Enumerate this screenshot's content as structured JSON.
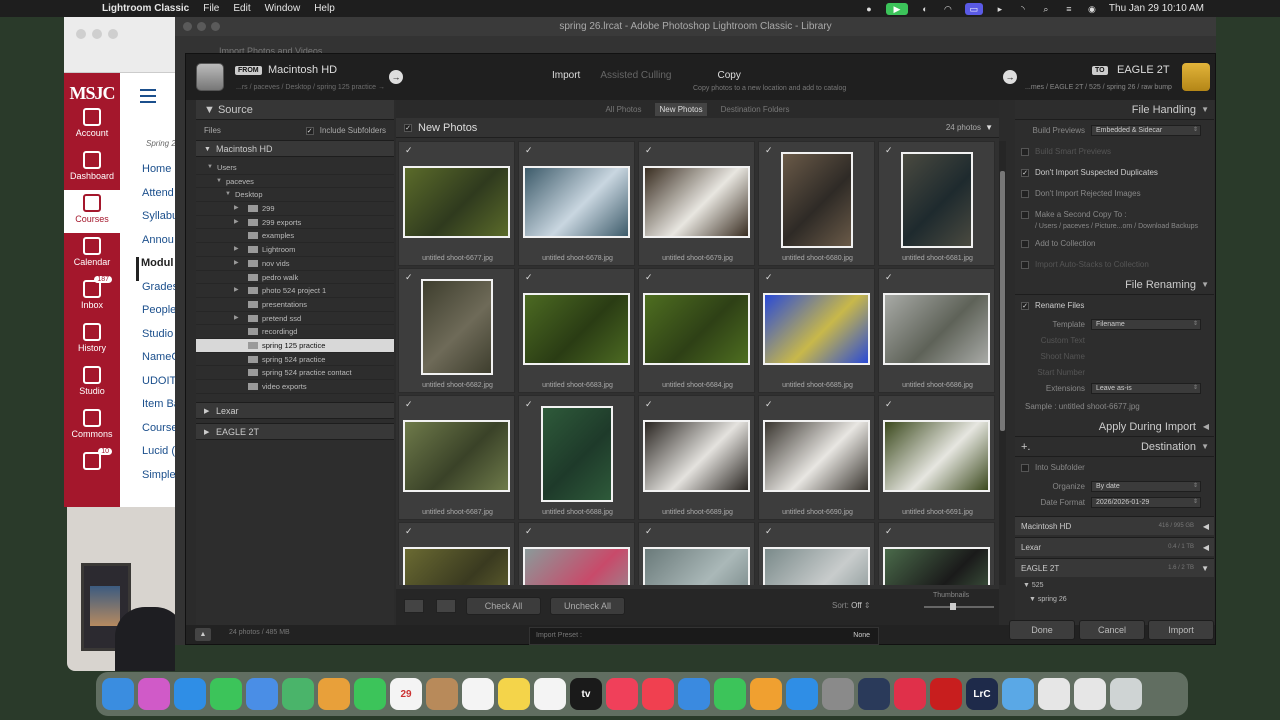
{
  "menubar": {
    "app": "Lightroom Classic",
    "items": [
      "File",
      "Edit",
      "Window",
      "Help"
    ],
    "clock": "Thu Jan 29  10:10 AM"
  },
  "browser": {
    "logo": "MSJC",
    "breadcrumb": "Spring 2",
    "nav": [
      {
        "label": "Account",
        "badge": ""
      },
      {
        "label": "Dashboard",
        "badge": ""
      },
      {
        "label": "Courses",
        "badge": ""
      },
      {
        "label": "Calendar",
        "badge": ""
      },
      {
        "label": "Inbox",
        "badge": "187"
      },
      {
        "label": "History",
        "badge": ""
      },
      {
        "label": "Studio",
        "badge": ""
      },
      {
        "label": "Commons",
        "badge": ""
      },
      {
        "label": "",
        "badge": "10"
      }
    ],
    "links": [
      "Home",
      "Attend",
      "Syllabu",
      "Annou",
      "Modul",
      "Grades",
      "People",
      "Studio",
      "NameC",
      "UDOIT",
      "Item Ba",
      "Course",
      "Lucid (",
      "Simple"
    ]
  },
  "lr_window": {
    "title": "spring 26.lrcat - Adobe Photoshop Lightroom Classic - Library",
    "subtitle": "Import Photos and Videos"
  },
  "import": {
    "from_tag": "FROM",
    "source_name": "Macintosh HD",
    "source_path": "...rs / paceves / Desktop / spring 125 practice →",
    "modes": {
      "import": "Import",
      "assisted": "Assisted Culling",
      "copy": "Copy"
    },
    "copy_hint": "Copy photos to a new location and add to catalog",
    "to_tag": "TO",
    "dest_name": "EAGLE 2T",
    "dest_path": "...mes / EAGLE 2T / 525 / spring 26 / raw bump"
  },
  "source_panel": {
    "header": "Source",
    "files_label": "Files",
    "include_subfolders": "Include Subfolders",
    "volume": "Macintosh HD",
    "tree": [
      {
        "label": "Users",
        "depth": 1,
        "tri": "▼",
        "folder": false
      },
      {
        "label": "paceves",
        "depth": 2,
        "tri": "▼",
        "folder": false
      },
      {
        "label": "Desktop",
        "depth": 3,
        "tri": "▼",
        "folder": false
      },
      {
        "label": "299",
        "depth": 4,
        "tri": "▶",
        "folder": true
      },
      {
        "label": "299 exports",
        "depth": 4,
        "tri": "▶",
        "folder": true
      },
      {
        "label": "examples",
        "depth": 4,
        "tri": "",
        "folder": true
      },
      {
        "label": "Lightroom",
        "depth": 4,
        "tri": "▶",
        "folder": true
      },
      {
        "label": "nov vids",
        "depth": 4,
        "tri": "▶",
        "folder": true
      },
      {
        "label": "pedro walk",
        "depth": 4,
        "tri": "",
        "folder": true
      },
      {
        "label": "photo 524 project 1",
        "depth": 4,
        "tri": "▶",
        "folder": true
      },
      {
        "label": "presentations",
        "depth": 4,
        "tri": "",
        "folder": true
      },
      {
        "label": "pretend ssd",
        "depth": 4,
        "tri": "▶",
        "folder": true
      },
      {
        "label": "recordingd",
        "depth": 4,
        "tri": "",
        "folder": true
      },
      {
        "label": "spring 125 practice",
        "depth": 4,
        "tri": "",
        "folder": true,
        "selected": true
      },
      {
        "label": "spring 524 practice",
        "depth": 4,
        "tri": "",
        "folder": true
      },
      {
        "label": "spring 524 practice  contact",
        "depth": 4,
        "tri": "",
        "folder": true
      },
      {
        "label": "video exports",
        "depth": 4,
        "tri": "",
        "folder": true
      }
    ],
    "other_volumes": [
      "Lexar",
      "EAGLE 2T"
    ]
  },
  "grid": {
    "tabs": [
      "All Photos",
      "New Photos",
      "Destination Folders"
    ],
    "header": "New Photos",
    "count": "24 photos",
    "photos": [
      {
        "name": "untitled shoot-6677.jpg",
        "colors": [
          "#5b6b2a",
          "#2f3a1e"
        ],
        "portrait": false
      },
      {
        "name": "untitled shoot-6678.jpg",
        "colors": [
          "#3d5b6a",
          "#c9d6e0"
        ],
        "portrait": false
      },
      {
        "name": "untitled shoot-6679.jpg",
        "colors": [
          "#3a2e22",
          "#e8e6e0"
        ],
        "portrait": false
      },
      {
        "name": "untitled shoot-6680.jpg",
        "colors": [
          "#6a5a48",
          "#2e2a26"
        ],
        "portrait": true
      },
      {
        "name": "untitled shoot-6681.jpg",
        "colors": [
          "#4a4a40",
          "#1e2a2e"
        ],
        "portrait": true
      },
      {
        "name": "untitled shoot-6682.jpg",
        "colors": [
          "#3e3e2e",
          "#6e6a58"
        ],
        "portrait": true
      },
      {
        "name": "untitled shoot-6683.jpg",
        "colors": [
          "#4c6a22",
          "#2a3c14"
        ],
        "portrait": false
      },
      {
        "name": "untitled shoot-6684.jpg",
        "colors": [
          "#4e6e20",
          "#2e4016"
        ],
        "portrait": false
      },
      {
        "name": "untitled shoot-6685.jpg",
        "colors": [
          "#2a4ad6",
          "#c8b84a"
        ],
        "portrait": false
      },
      {
        "name": "untitled shoot-6686.jpg",
        "colors": [
          "#a8aaa6",
          "#5e6258"
        ],
        "portrait": false
      },
      {
        "name": "untitled shoot-6687.jpg",
        "colors": [
          "#6e7a4a",
          "#3a4228"
        ],
        "portrait": false
      },
      {
        "name": "untitled shoot-6688.jpg",
        "colors": [
          "#2e5a3a",
          "#1e3a2a"
        ],
        "portrait": true
      },
      {
        "name": "untitled shoot-6689.jpg",
        "colors": [
          "#2a2622",
          "#e4e2de"
        ],
        "portrait": false
      },
      {
        "name": "untitled shoot-6690.jpg",
        "colors": [
          "#3a3630",
          "#e8e6e2"
        ],
        "portrait": false
      },
      {
        "name": "untitled shoot-6691.jpg",
        "colors": [
          "#3c4a1e",
          "#e6e6e0"
        ],
        "portrait": false
      },
      {
        "name": "",
        "colors": [
          "#6a6a32",
          "#3a3a20"
        ],
        "portrait": false
      },
      {
        "name": "",
        "colors": [
          "#8a9a9a",
          "#c84a6a"
        ],
        "portrait": false
      },
      {
        "name": "",
        "colors": [
          "#6a7a7a",
          "#aab8b8"
        ],
        "portrait": false
      },
      {
        "name": "",
        "colors": [
          "#7a8a8a",
          "#c8cccc"
        ],
        "portrait": false
      },
      {
        "name": "",
        "colors": [
          "#4a6a4a",
          "#1a1a1a"
        ],
        "portrait": false
      }
    ],
    "check_all": "Check All",
    "uncheck_all": "Uncheck All",
    "sort_label": "Sort:",
    "sort_value": "Off",
    "thumbnails_label": "Thumbnails"
  },
  "right_panel": {
    "file_handling": "File Handling",
    "build_previews_label": "Build Previews",
    "build_previews_value": "Embedded & Sidecar",
    "smart_previews": "Build Smart Previews",
    "dont_import_dupes": "Don't Import Suspected Duplicates",
    "dont_import_rejected": "Don't Import Rejected Images",
    "second_copy": "Make a Second Copy To :",
    "second_copy_path": "/ Users / paceves / Picture...om / Download Backups",
    "add_collection": "Add to Collection",
    "auto_stacks": "Import Auto-Stacks to Collection",
    "file_renaming": "File Renaming",
    "rename_files": "Rename Files",
    "template_label": "Template",
    "template_value": "Filename",
    "custom_text": "Custom Text",
    "shoot_name": "Shoot Name",
    "start_number": "Start Number",
    "extensions_label": "Extensions",
    "extensions_value": "Leave as-is",
    "sample": "Sample :  untitled shoot-6677.jpg",
    "apply_during_import": "Apply During Import",
    "destination": "Destination",
    "into_subfolder": "Into Subfolder",
    "organize_label": "Organize",
    "organize_value": "By date",
    "date_format_label": "Date Format",
    "date_format_value": "2026/2026-01-29",
    "volumes": [
      {
        "name": "Macintosh HD",
        "size": "416 / 995 GB",
        "tri": "◀"
      },
      {
        "name": "Lexar",
        "size": "0.4 / 1 TB",
        "tri": "◀"
      },
      {
        "name": "EAGLE 2T",
        "size": "1.6 / 2 TB",
        "tri": "▼"
      }
    ],
    "sub_folders": [
      "525",
      "spring 26"
    ]
  },
  "bottom": {
    "info": "24 photos / 485 MB",
    "preset_label": "Import Preset :",
    "preset_value": "None",
    "done": "Done",
    "cancel": "Cancel",
    "import": "Import"
  },
  "dock": {
    "apps": [
      {
        "name": "finder-icon",
        "color": "#3a8de0",
        "label": ""
      },
      {
        "name": "launchpad-icon",
        "color": "#d05ac8",
        "label": ""
      },
      {
        "name": "safari-icon",
        "color": "#2f8ee6",
        "label": ""
      },
      {
        "name": "messages-icon",
        "color": "#3cc45a",
        "label": ""
      },
      {
        "name": "mail-icon",
        "color": "#4a8ee6",
        "label": ""
      },
      {
        "name": "maps-icon",
        "color": "#4ab46a",
        "label": ""
      },
      {
        "name": "photos-icon",
        "color": "#e8a03a",
        "label": ""
      },
      {
        "name": "facetime-icon",
        "color": "#3cc45a",
        "label": ""
      },
      {
        "name": "calendar-icon",
        "color": "#f4f4f4",
        "label": "29"
      },
      {
        "name": "contacts-icon",
        "color": "#b88a5a",
        "label": ""
      },
      {
        "name": "reminders-icon",
        "color": "#f4f4f4",
        "label": ""
      },
      {
        "name": "notes-icon",
        "color": "#f4d44a",
        "label": ""
      },
      {
        "name": "freeform-icon",
        "color": "#f4f4f4",
        "label": ""
      },
      {
        "name": "tv-icon",
        "color": "#1a1a1a",
        "label": "tv"
      },
      {
        "name": "music-icon",
        "color": "#f0405a",
        "label": ""
      },
      {
        "name": "news-icon",
        "color": "#f04050",
        "label": ""
      },
      {
        "name": "keynote-icon",
        "color": "#3a8ae0",
        "label": ""
      },
      {
        "name": "numbers-icon",
        "color": "#3cc45a",
        "label": ""
      },
      {
        "name": "pages-icon",
        "color": "#f0a030",
        "label": ""
      },
      {
        "name": "app-store-icon",
        "color": "#2f8ee6",
        "label": ""
      },
      {
        "name": "settings-icon",
        "color": "#8a8a8a",
        "label": ""
      },
      {
        "name": "quicktime-icon",
        "color": "#2a3a5a",
        "label": ""
      },
      {
        "name": "creative-cloud-icon",
        "color": "#e0304a",
        "label": ""
      },
      {
        "name": "acrobat-icon",
        "color": "#c81e1e",
        "label": ""
      },
      {
        "name": "lightroom-classic-icon",
        "color": "#1e2a4a",
        "label": "LrC"
      },
      {
        "name": "folder-icon",
        "color": "#5aa8e6",
        "label": ""
      },
      {
        "name": "document-icon",
        "color": "#e6e6e6",
        "label": ""
      },
      {
        "name": "document-icon-2",
        "color": "#e6e6e6",
        "label": ""
      },
      {
        "name": "trash-icon",
        "color": "#cfd4d4",
        "label": ""
      }
    ]
  }
}
